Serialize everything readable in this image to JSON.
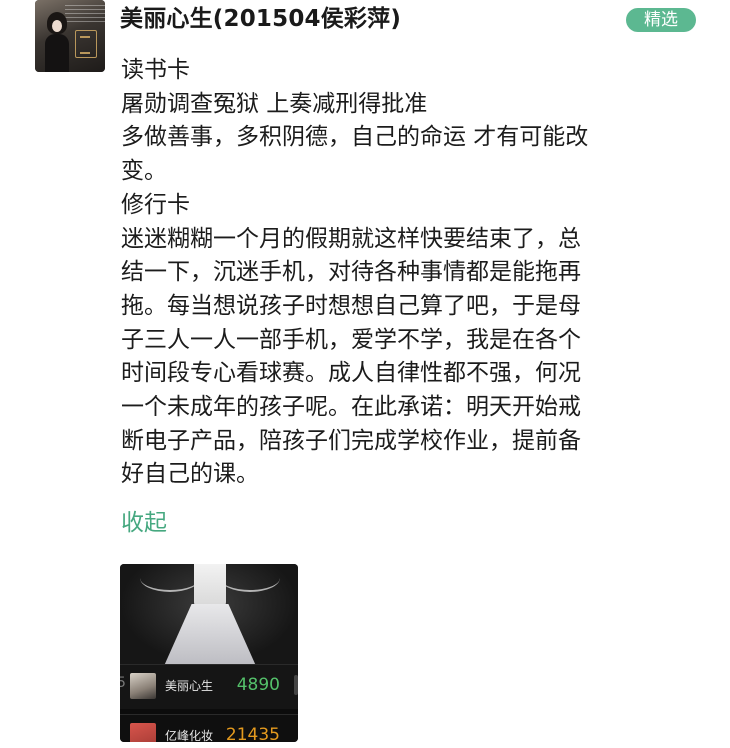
{
  "header": {
    "username": "美丽心生(201504侯彩萍)",
    "badge": "精选"
  },
  "post": {
    "lines": [
      "读书卡",
      "屠勋调查冤狱 上奏减刑得批准",
      "多做善事，多积阴德，自己的命运 才有可能改",
      "变。",
      "修行卡",
      "迷迷糊糊一个月的假期就这样快要结束了，总",
      "结一下，沉迷手机，对待各种事情都是能拖再",
      "拖。每当想说孩子时想想自己算了吧，于是母",
      "子三人一人一部手机，爱学不学，我是在各个",
      "时间段专心看球赛。成人自律性都不强，何况",
      "一个未成年的孩子呢。在此承诺：明天开始戒",
      "断电子产品，陪孩子们完成学校作业，提前备",
      "好自己的课。"
    ],
    "collapse_label": "收起"
  },
  "media": {
    "rows": [
      {
        "rank": "5",
        "name": "美丽心生",
        "score": "4890",
        "score_color": "#54c06a"
      },
      {
        "rank": "",
        "name": "亿峰化妆",
        "score": "21435",
        "score_color": "#e49a1e"
      }
    ]
  },
  "colors": {
    "accent_green": "#5cb891",
    "link_green": "#46a880"
  }
}
